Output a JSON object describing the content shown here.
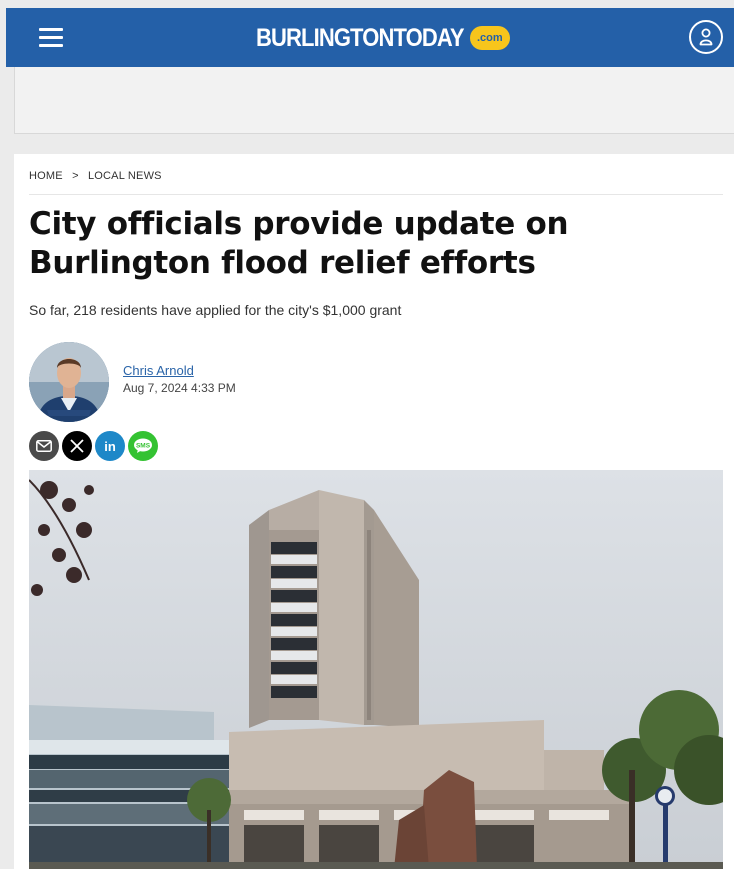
{
  "header": {
    "logo_text": "BURLINGTONTODAY",
    "logo_badge": ".com",
    "colors": {
      "bar": "#2460a8",
      "badge": "#f7c51c"
    }
  },
  "breadcrumb": {
    "home": "HOME",
    "separator": ">",
    "section": "LOCAL NEWS"
  },
  "article": {
    "headline": "City officials provide update on Burlington flood relief efforts",
    "subheadline": "So far, 218 residents have applied for the city's $1,000 grant",
    "author": "Chris Arnold",
    "date": "Aug 7, 2024 4:33 PM"
  },
  "share": {
    "buttons": [
      {
        "name": "email-share-icon",
        "color": "#4a4a4a"
      },
      {
        "name": "x-share-icon",
        "color": "#000000"
      },
      {
        "name": "linkedin-share-icon",
        "color": "#1e88c8",
        "label": "in"
      },
      {
        "name": "sms-share-icon",
        "color": "#34c232",
        "label": "SMS"
      }
    ]
  }
}
